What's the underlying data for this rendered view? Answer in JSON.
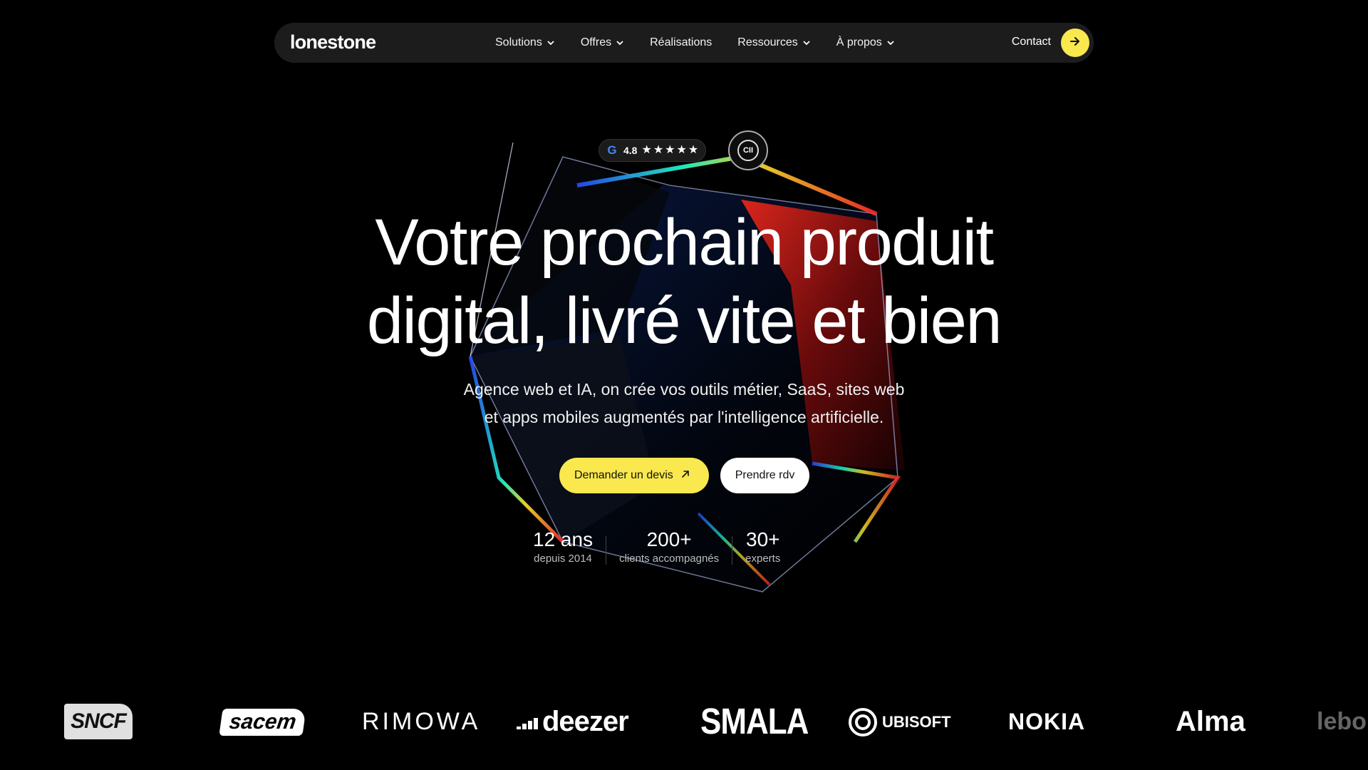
{
  "nav": {
    "logo": "lonestone",
    "items": [
      {
        "label": "Solutions",
        "dropdown": true
      },
      {
        "label": "Offres",
        "dropdown": true
      },
      {
        "label": "Réalisations",
        "dropdown": false
      },
      {
        "label": "Ressources",
        "dropdown": true
      },
      {
        "label": "À propos",
        "dropdown": true
      }
    ],
    "contact": "Contact"
  },
  "rating": {
    "score": "4.8",
    "stars": 5
  },
  "badge": {
    "label": "CII"
  },
  "hero": {
    "title_line1": "Votre prochain produit",
    "title_line2": "digital, livré vite et bien",
    "subtitle_line1": "Agence web et IA, on crée vos outils métier, SaaS, sites web",
    "subtitle_line2": "et apps mobiles augmentés par l'intelligence artificielle.",
    "cta_primary": "Demander un devis",
    "cta_secondary": "Prendre rdv"
  },
  "stats": [
    {
      "value": "12 ans",
      "label": "depuis 2014"
    },
    {
      "value": "200+",
      "label": "clients accompagnés"
    },
    {
      "value": "30+",
      "label": "experts"
    }
  ],
  "logos": {
    "sncf": "SNCF",
    "sacem": "sacem",
    "rimowa": "RIMOWA",
    "deezer": "deezer",
    "smala": "SMALA",
    "ubisoft": "UBISOFT",
    "nokia": "NOKIA",
    "alma": "Alma",
    "lebo": "lebo"
  },
  "colors": {
    "accent": "#f9e84e",
    "background": "#000000",
    "nav_bg": "#1c1c1c"
  }
}
